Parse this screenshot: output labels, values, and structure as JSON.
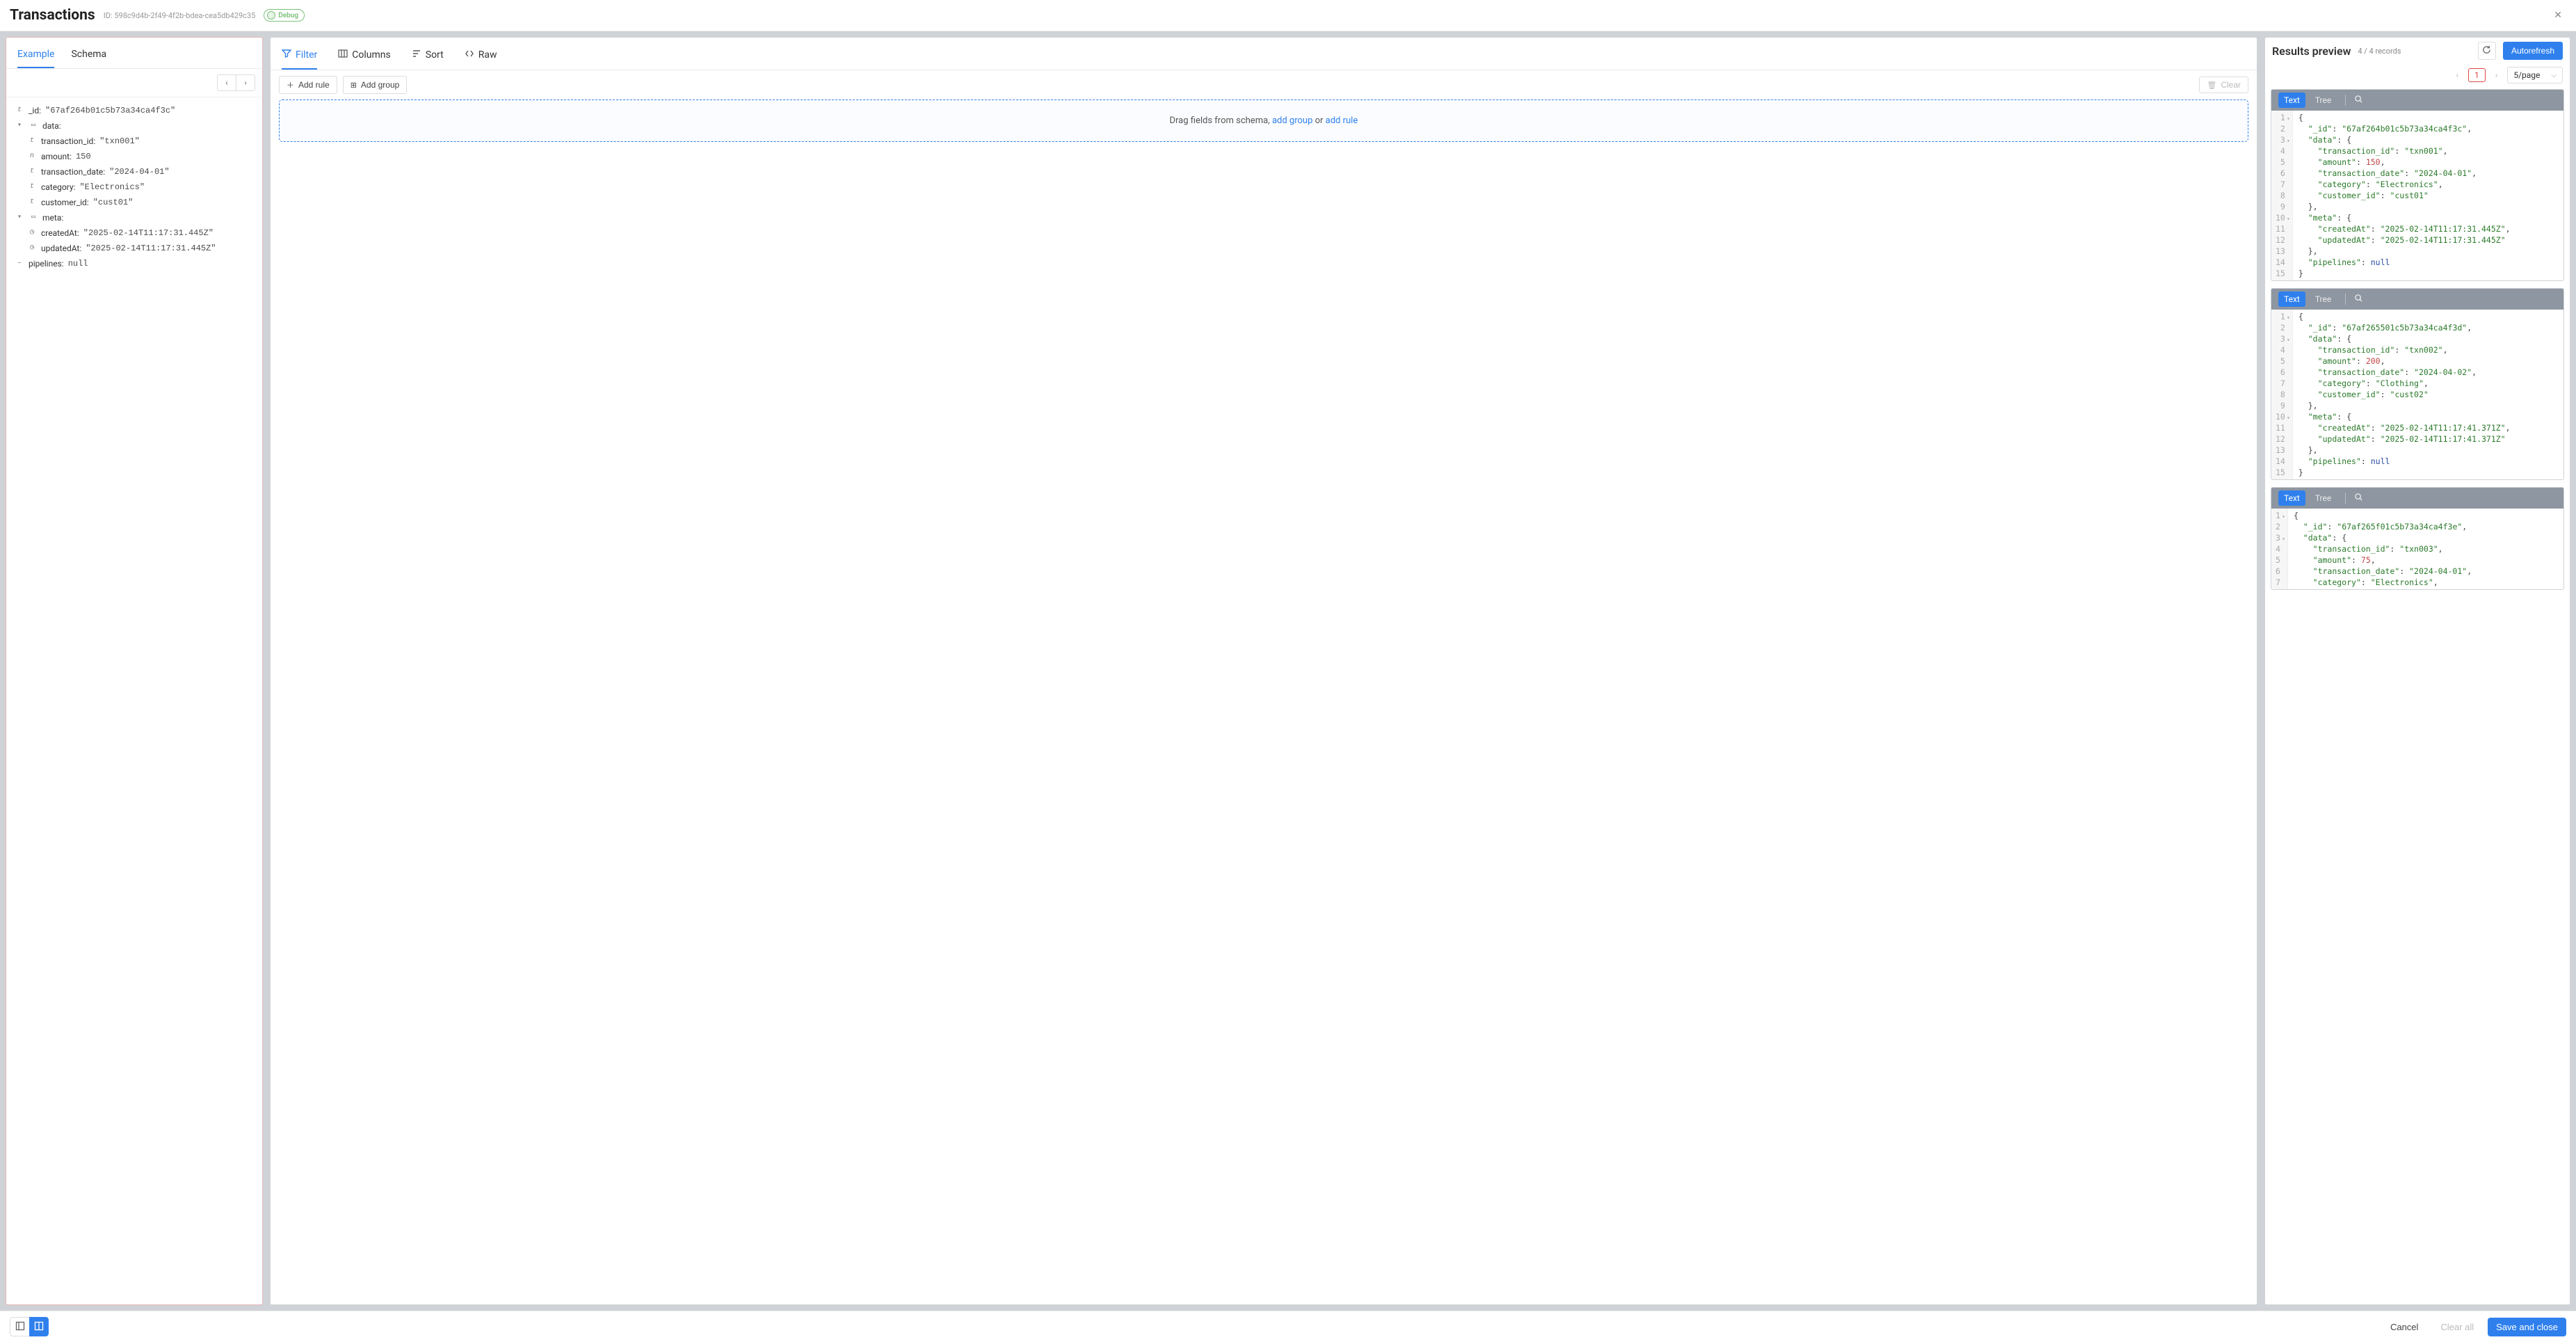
{
  "header": {
    "title": "Transactions",
    "id_prefix": "ID:",
    "id_value": "598c9d4b-2f49-4f2b-bdea-cea5db429c35",
    "debug_label": "Debug"
  },
  "left": {
    "tabs": [
      "Example",
      "Schema"
    ],
    "active_tab": 0,
    "nav": {
      "prev": "‹",
      "next": "›"
    },
    "fields": {
      "_id": {
        "key": "_id",
        "type": "t",
        "value": "\"67af264b01c5b73a34ca4f3c\""
      },
      "data": {
        "key": "data",
        "type": "obj",
        "children": {
          "transaction_id": {
            "key": "transaction_id",
            "type": "t",
            "value": "\"txn001\""
          },
          "amount": {
            "key": "amount",
            "type": "n",
            "value": "150"
          },
          "transaction_date": {
            "key": "transaction_date",
            "type": "t",
            "value": "\"2024-04-01\""
          },
          "category": {
            "key": "category",
            "type": "t",
            "value": "\"Electronics\""
          },
          "customer_id": {
            "key": "customer_id",
            "type": "t",
            "value": "\"cust01\""
          }
        }
      },
      "meta": {
        "key": "meta",
        "type": "obj",
        "children": {
          "createdAt": {
            "key": "createdAt",
            "type": "clock",
            "value": "\"2025-02-14T11:17:31.445Z\""
          },
          "updatedAt": {
            "key": "updatedAt",
            "type": "clock",
            "value": "\"2025-02-14T11:17:31.445Z\""
          }
        }
      },
      "pipelines": {
        "key": "pipelines",
        "type": "dash",
        "value": "null"
      }
    }
  },
  "middle": {
    "tabs": [
      "Filter",
      "Columns",
      "Sort",
      "Raw"
    ],
    "active_tab": 0,
    "add_rule": "Add rule",
    "add_group": "Add group",
    "clear": "Clear",
    "drop_prefix": "Drag fields from schema, ",
    "drop_link1": "add group",
    "drop_or": " or ",
    "drop_link2": "add rule"
  },
  "right": {
    "title": "Results preview",
    "count": "4 / 4 records",
    "autorefresh": "Autorefresh",
    "page_current": "1",
    "page_size": "5/page",
    "view_tabs": [
      "Text",
      "Tree"
    ],
    "records": [
      {
        "lines": 15,
        "folds": [
          1,
          3,
          10
        ],
        "tokens": [
          [
            [
              "",
              "{"
            ]
          ],
          [
            [
              "  "
            ],
            [
              "k",
              "\"_id\""
            ],
            [
              "",
              ": "
            ],
            [
              "s",
              "\"67af264b01c5b73a34ca4f3c\""
            ],
            [
              "",
              ","
            ]
          ],
          [
            [
              "  "
            ],
            [
              "k",
              "\"data\""
            ],
            [
              "",
              ": {"
            ]
          ],
          [
            [
              "    "
            ],
            [
              "k",
              "\"transaction_id\""
            ],
            [
              "",
              ": "
            ],
            [
              "s",
              "\"txn001\""
            ],
            [
              "",
              ","
            ]
          ],
          [
            [
              "    "
            ],
            [
              "k",
              "\"amount\""
            ],
            [
              "",
              ": "
            ],
            [
              "n",
              "150"
            ],
            [
              "",
              ","
            ]
          ],
          [
            [
              "    "
            ],
            [
              "k",
              "\"transaction_date\""
            ],
            [
              "",
              ": "
            ],
            [
              "s",
              "\"2024-04-01\""
            ],
            [
              "",
              ","
            ]
          ],
          [
            [
              "    "
            ],
            [
              "k",
              "\"category\""
            ],
            [
              "",
              ": "
            ],
            [
              "s",
              "\"Electronics\""
            ],
            [
              "",
              ","
            ]
          ],
          [
            [
              "    "
            ],
            [
              "k",
              "\"customer_id\""
            ],
            [
              "",
              ": "
            ],
            [
              "s",
              "\"cust01\""
            ]
          ],
          [
            [
              "  },"
            ]
          ],
          [
            [
              "  "
            ],
            [
              "k",
              "\"meta\""
            ],
            [
              "",
              ": {"
            ]
          ],
          [
            [
              "    "
            ],
            [
              "k",
              "\"createdAt\""
            ],
            [
              "",
              ": "
            ],
            [
              "s",
              "\"2025-02-14T11:17:31.445Z\""
            ],
            [
              "",
              ","
            ]
          ],
          [
            [
              "    "
            ],
            [
              "k",
              "\"updatedAt\""
            ],
            [
              "",
              ": "
            ],
            [
              "s",
              "\"2025-02-14T11:17:31.445Z\""
            ]
          ],
          [
            [
              "  },"
            ]
          ],
          [
            [
              "  "
            ],
            [
              "k",
              "\"pipelines\""
            ],
            [
              "",
              ": "
            ],
            [
              "u",
              "null"
            ]
          ],
          [
            [
              "}"
            ]
          ]
        ]
      },
      {
        "lines": 15,
        "folds": [
          1,
          3,
          10
        ],
        "tokens": [
          [
            [
              "",
              "{"
            ]
          ],
          [
            [
              "  "
            ],
            [
              "k",
              "\"_id\""
            ],
            [
              "",
              ": "
            ],
            [
              "s",
              "\"67af265501c5b73a34ca4f3d\""
            ],
            [
              "",
              ","
            ]
          ],
          [
            [
              "  "
            ],
            [
              "k",
              "\"data\""
            ],
            [
              "",
              ": {"
            ]
          ],
          [
            [
              "    "
            ],
            [
              "k",
              "\"transaction_id\""
            ],
            [
              "",
              ": "
            ],
            [
              "s",
              "\"txn002\""
            ],
            [
              "",
              ","
            ]
          ],
          [
            [
              "    "
            ],
            [
              "k",
              "\"amount\""
            ],
            [
              "",
              ": "
            ],
            [
              "n",
              "200"
            ],
            [
              "",
              ","
            ]
          ],
          [
            [
              "    "
            ],
            [
              "k",
              "\"transaction_date\""
            ],
            [
              "",
              ": "
            ],
            [
              "s",
              "\"2024-04-02\""
            ],
            [
              "",
              ","
            ]
          ],
          [
            [
              "    "
            ],
            [
              "k",
              "\"category\""
            ],
            [
              "",
              ": "
            ],
            [
              "s",
              "\"Clothing\""
            ],
            [
              "",
              ","
            ]
          ],
          [
            [
              "    "
            ],
            [
              "k",
              "\"customer_id\""
            ],
            [
              "",
              ": "
            ],
            [
              "s",
              "\"cust02\""
            ]
          ],
          [
            [
              "  },"
            ]
          ],
          [
            [
              "  "
            ],
            [
              "k",
              "\"meta\""
            ],
            [
              "",
              ": {"
            ]
          ],
          [
            [
              "    "
            ],
            [
              "k",
              "\"createdAt\""
            ],
            [
              "",
              ": "
            ],
            [
              "s",
              "\"2025-02-14T11:17:41.371Z\""
            ],
            [
              "",
              ","
            ]
          ],
          [
            [
              "    "
            ],
            [
              "k",
              "\"updatedAt\""
            ],
            [
              "",
              ": "
            ],
            [
              "s",
              "\"2025-02-14T11:17:41.371Z\""
            ]
          ],
          [
            [
              "  },"
            ]
          ],
          [
            [
              "  "
            ],
            [
              "k",
              "\"pipelines\""
            ],
            [
              "",
              ": "
            ],
            [
              "u",
              "null"
            ]
          ],
          [
            [
              "}"
            ]
          ]
        ]
      },
      {
        "lines": 7,
        "folds": [
          1,
          3
        ],
        "tokens": [
          [
            [
              "",
              "{"
            ]
          ],
          [
            [
              "  "
            ],
            [
              "k",
              "\"_id\""
            ],
            [
              "",
              ": "
            ],
            [
              "s",
              "\"67af265f01c5b73a34ca4f3e\""
            ],
            [
              "",
              ","
            ]
          ],
          [
            [
              "  "
            ],
            [
              "k",
              "\"data\""
            ],
            [
              "",
              ": {"
            ]
          ],
          [
            [
              "    "
            ],
            [
              "k",
              "\"transaction_id\""
            ],
            [
              "",
              ": "
            ],
            [
              "s",
              "\"txn003\""
            ],
            [
              "",
              ","
            ]
          ],
          [
            [
              "    "
            ],
            [
              "k",
              "\"amount\""
            ],
            [
              "",
              ": "
            ],
            [
              "n",
              "75"
            ],
            [
              "",
              ","
            ]
          ],
          [
            [
              "    "
            ],
            [
              "k",
              "\"transaction_date\""
            ],
            [
              "",
              ": "
            ],
            [
              "s",
              "\"2024-04-01\""
            ],
            [
              "",
              ","
            ]
          ],
          [
            [
              "    "
            ],
            [
              "k",
              "\"category\""
            ],
            [
              "",
              ": "
            ],
            [
              "s",
              "\"Electronics\""
            ],
            [
              "",
              ","
            ]
          ]
        ]
      }
    ]
  },
  "footer": {
    "cancel": "Cancel",
    "clear_all": "Clear all",
    "save": "Save and close"
  }
}
